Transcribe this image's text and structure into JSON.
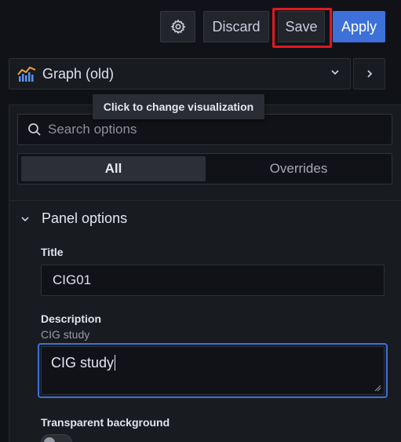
{
  "toolbar": {
    "settings_icon": "gear-icon",
    "discard_label": "Discard",
    "save_label": "Save",
    "apply_label": "Apply"
  },
  "visualization": {
    "icon": "graph-icon",
    "label": "Graph (old)",
    "tooltip": "Click to change visualization"
  },
  "search": {
    "placeholder": "Search options"
  },
  "tabs": [
    {
      "label": "All",
      "active": true
    },
    {
      "label": "Overrides",
      "active": false
    }
  ],
  "panel_options": {
    "header": "Panel options",
    "title_label": "Title",
    "title_value": "CIG01",
    "description_label": "Description",
    "description_preview": "CIG study",
    "description_value": "CIG study",
    "transparent_label": "Transparent background",
    "transparent_on": false
  },
  "colors": {
    "accent": "#3d71d9",
    "highlight_frame": "#e0191f",
    "background": "#111217"
  }
}
